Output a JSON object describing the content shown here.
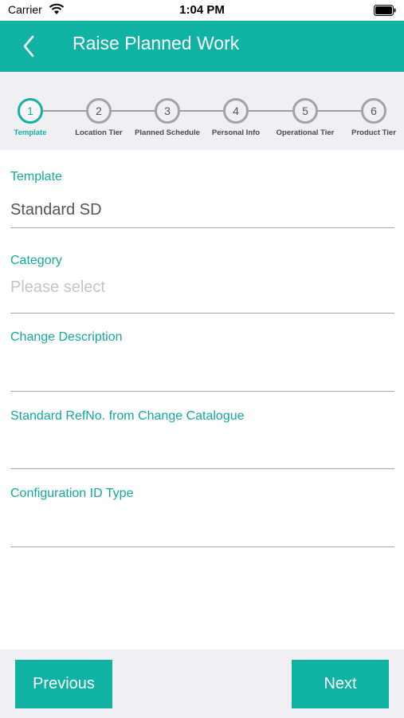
{
  "status_bar": {
    "carrier": "Carrier",
    "time": "1:04 PM"
  },
  "header": {
    "title": "Raise Planned Work",
    "back_icon": "chevron-left-icon"
  },
  "stepper": {
    "active_step": 1,
    "steps": [
      {
        "number": "1",
        "label": "Template"
      },
      {
        "number": "2",
        "label": "Location Tier"
      },
      {
        "number": "3",
        "label": "Planned Schedule"
      },
      {
        "number": "4",
        "label": "Personal Info"
      },
      {
        "number": "5",
        "label": "Operational Tier"
      },
      {
        "number": "6",
        "label": "Product Tier"
      }
    ]
  },
  "form": {
    "fields": [
      {
        "label": "Template",
        "value": "Standard SD",
        "placeholder": ""
      },
      {
        "label": "Category",
        "value": "",
        "placeholder": "Please select"
      },
      {
        "label": "Change Description",
        "value": "",
        "placeholder": ""
      },
      {
        "label": "Standard RefNo. from Change Catalogue",
        "value": "",
        "placeholder": ""
      },
      {
        "label": "Configuration ID Type",
        "value": "",
        "placeholder": ""
      }
    ]
  },
  "footer": {
    "previous_label": "Previous",
    "next_label": "Next"
  },
  "colors": {
    "accent": "#10b3a3",
    "step_inactive": "#a3a3a3",
    "background_gray": "#efeff4"
  }
}
